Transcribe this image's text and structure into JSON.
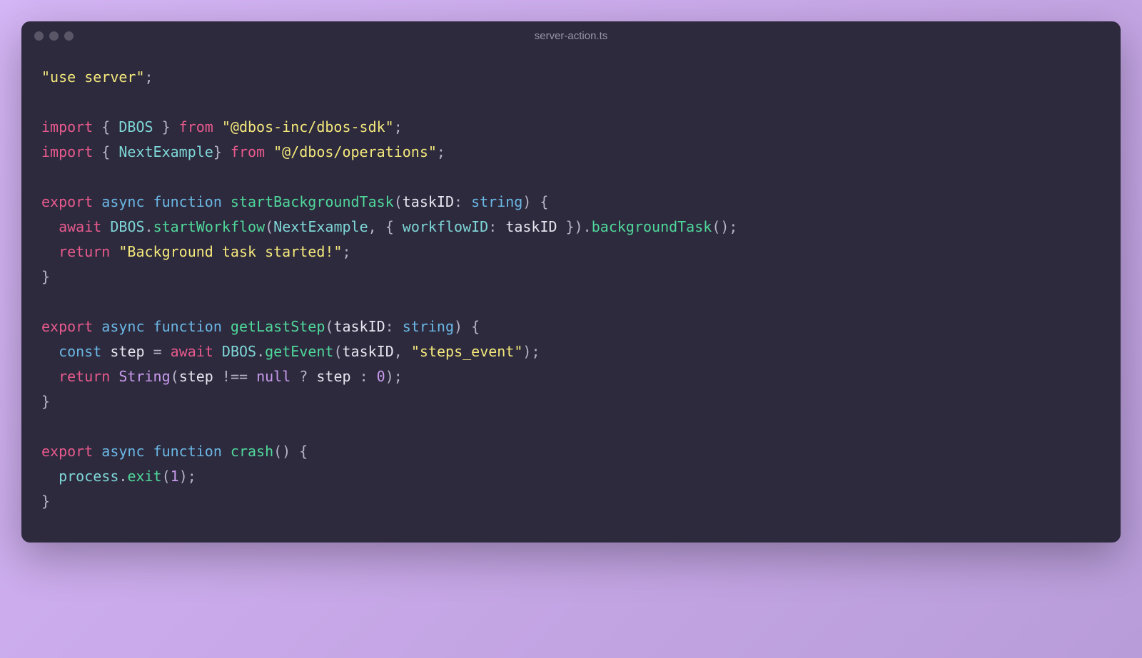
{
  "window": {
    "filename": "server-action.ts"
  },
  "code": {
    "line1_useserver": "\"use server\"",
    "line1_semi": ";",
    "line3_import": "import",
    "line3_brace_open": " { ",
    "line3_dbos": "DBOS",
    "line3_brace_close": " } ",
    "line3_from": "from",
    "line3_pkg": " \"@dbos-inc/dbos-sdk\"",
    "line3_semi": ";",
    "line4_import": "import",
    "line4_brace_open": " { ",
    "line4_nextexample": "NextExample",
    "line4_brace_close": "} ",
    "line4_from": "from",
    "line4_pkg": " \"@/dbos/operations\"",
    "line4_semi": ";",
    "line6_export": "export",
    "line6_async": " async",
    "line6_function": " function",
    "line6_fname": " startBackgroundTask",
    "line6_paren_open": "(",
    "line6_param": "taskID",
    "line6_colon": ": ",
    "line6_type": "string",
    "line6_paren_close": ") {",
    "line7_indent": "  ",
    "line7_await": "await",
    "line7_sp": " ",
    "line7_dbos": "DBOS",
    "line7_dot1": ".",
    "line7_startworkflow": "startWorkflow",
    "line7_paren_open": "(",
    "line7_nextexample": "NextExample",
    "line7_comma": ", { ",
    "line7_workflowid": "workflowID",
    "line7_colon": ": ",
    "line7_taskid": "taskID",
    "line7_close_obj": " }).",
    "line7_backgroundtask": "backgroundTask",
    "line7_call": "();",
    "line8_indent": "  ",
    "line8_return": "return",
    "line8_str": " \"Background task started!\"",
    "line8_semi": ";",
    "line9_close": "}",
    "line11_export": "export",
    "line11_async": " async",
    "line11_function": " function",
    "line11_fname": " getLastStep",
    "line11_paren_open": "(",
    "line11_param": "taskID",
    "line11_colon": ": ",
    "line11_type": "string",
    "line11_paren_close": ") {",
    "line12_indent": "  ",
    "line12_const": "const",
    "line12_sp": " ",
    "line12_step": "step",
    "line12_eq": " = ",
    "line12_await": "await",
    "line12_sp2": " ",
    "line12_dbos": "DBOS",
    "line12_dot": ".",
    "line12_getevent": "getEvent",
    "line12_paren_open": "(",
    "line12_taskid": "taskID",
    "line12_comma": ", ",
    "line12_str": "\"steps_event\"",
    "line12_close": ");",
    "line13_indent": "  ",
    "line13_return": "return",
    "line13_sp": " ",
    "line13_string_fn": "String",
    "line13_paren_open": "(",
    "line13_step": "step",
    "line13_neq": " !== ",
    "line13_null": "null",
    "line13_tern": " ? ",
    "line13_step2": "step",
    "line13_colon": " : ",
    "line13_zero": "0",
    "line13_close": ");",
    "line14_close": "}",
    "line16_export": "export",
    "line16_async": " async",
    "line16_function": " function",
    "line16_fname": " crash",
    "line16_parens": "() {",
    "line17_indent": "  ",
    "line17_process": "process",
    "line17_dot": ".",
    "line17_exit": "exit",
    "line17_paren_open": "(",
    "line17_one": "1",
    "line17_close": ");",
    "line18_close": "}"
  }
}
